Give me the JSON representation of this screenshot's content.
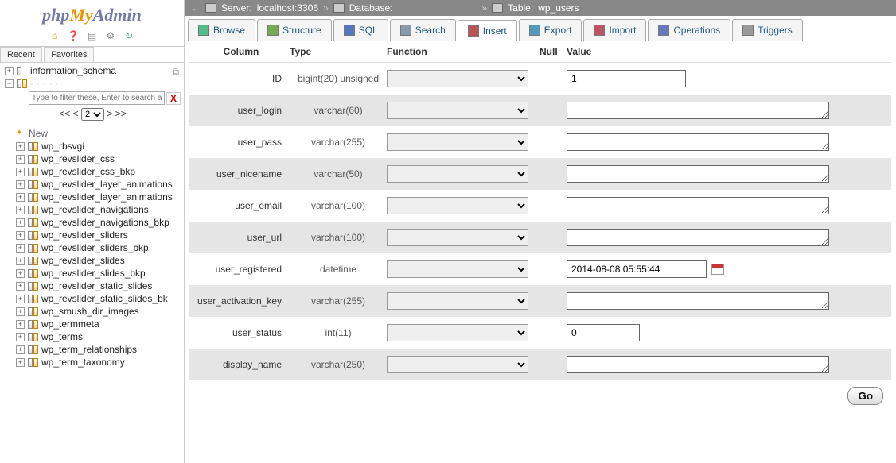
{
  "logo": {
    "php": "php",
    "my": "My",
    "admin": "Admin"
  },
  "sidebar": {
    "tab_recent": "Recent",
    "tab_fav": "Favorites",
    "filter_placeholder": "Type to filter these, Enter to search all",
    "filter_x": "X",
    "pager_prev": "<< <",
    "pager_next": "> >>",
    "pager_val": "2",
    "db1": "information_schema",
    "new": "New",
    "tables": [
      "wp_rbsvgi",
      "wp_revslider_css",
      "wp_revslider_css_bkp",
      "wp_revslider_layer_animations",
      "wp_revslider_layer_animations",
      "wp_revslider_navigations",
      "wp_revslider_navigations_bkp",
      "wp_revslider_sliders",
      "wp_revslider_sliders_bkp",
      "wp_revslider_slides",
      "wp_revslider_slides_bkp",
      "wp_revslider_static_slides",
      "wp_revslider_static_slides_bk",
      "wp_smush_dir_images",
      "wp_termmeta",
      "wp_terms",
      "wp_term_relationships",
      "wp_term_taxonomy"
    ]
  },
  "breadcrumb": {
    "server_lbl": "Server:",
    "server_val": "localhost:3306",
    "db_lbl": "Database:",
    "db_val": "",
    "tbl_lbl": "Table:",
    "tbl_val": "wp_users"
  },
  "nav": {
    "browse": "Browse",
    "structure": "Structure",
    "sql": "SQL",
    "search": "Search",
    "insert": "Insert",
    "export": "Export",
    "import": "Import",
    "operations": "Operations",
    "triggers": "Triggers"
  },
  "headers": {
    "column": "Column",
    "type": "Type",
    "function": "Function",
    "nul": "Null",
    "value": "Value"
  },
  "rows": [
    {
      "col": "ID",
      "type": "bigint(20) unsigned",
      "val": "1",
      "w": "med",
      "kind": "input"
    },
    {
      "col": "user_login",
      "type": "varchar(60)",
      "val": "",
      "w": "long",
      "kind": "textarea"
    },
    {
      "col": "user_pass",
      "type": "varchar(255)",
      "val": "",
      "w": "long",
      "kind": "textarea"
    },
    {
      "col": "user_nicename",
      "type": "varchar(50)",
      "val": "",
      "w": "long",
      "kind": "textarea"
    },
    {
      "col": "user_email",
      "type": "varchar(100)",
      "val": "",
      "w": "long",
      "kind": "textarea"
    },
    {
      "col": "user_url",
      "type": "varchar(100)",
      "val": "",
      "w": "long",
      "kind": "textarea"
    },
    {
      "col": "user_registered",
      "type": "datetime",
      "val": "2014-08-08 05:55:44",
      "w": "date",
      "kind": "date"
    },
    {
      "col": "user_activation_key",
      "type": "varchar(255)",
      "val": "",
      "w": "long",
      "kind": "textarea"
    },
    {
      "col": "user_status",
      "type": "int(11)",
      "val": "0",
      "w": "short",
      "kind": "input"
    },
    {
      "col": "display_name",
      "type": "varchar(250)",
      "val": "",
      "w": "long",
      "kind": "textarea"
    }
  ],
  "go": "Go",
  "nav_icons": {
    "browse": "#5b8",
    "structure": "#7a5",
    "sql": "#57b",
    "search": "#89a",
    "insert": "#b55",
    "export": "#59b",
    "import": "#b56",
    "operations": "#67b",
    "triggers": "#999"
  }
}
